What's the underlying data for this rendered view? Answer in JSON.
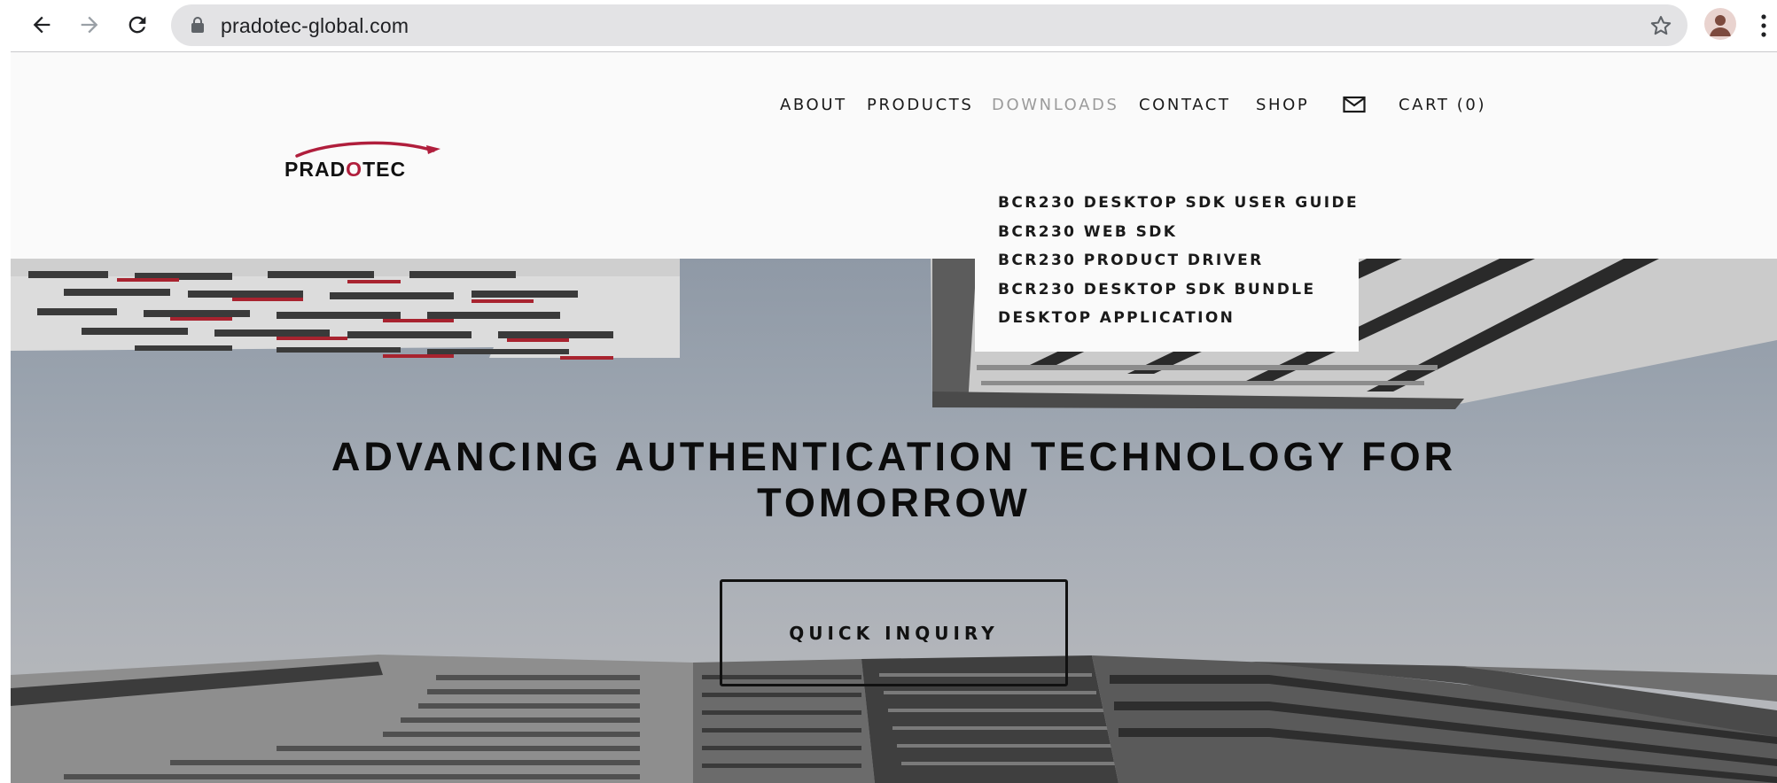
{
  "browser": {
    "url": "pradotec-global.com",
    "icons": {
      "back": "arrow-left-icon",
      "forward": "arrow-right-icon",
      "reload": "reload-icon",
      "lock": "lock-icon",
      "bookmark": "star-icon",
      "profile": "avatar-icon",
      "menu": "kebab-menu-icon"
    }
  },
  "site": {
    "logo_text_pre": "PRAD",
    "logo_text_o": "O",
    "logo_text_post": "TEC",
    "brand_colors": {
      "red": "#b01e3c",
      "dark": "#111111"
    }
  },
  "nav": {
    "about": "ABOUT",
    "products": "PRODUCTS",
    "downloads": "DOWNLOADS",
    "contact": "CONTACT",
    "shop": "SHOP",
    "cart": "CART (0)",
    "mail_icon": "envelope-icon"
  },
  "downloads_menu": {
    "items": [
      "BCR230 DESKTOP SDK USER GUIDE",
      "BCR230 WEB SDK",
      "BCR230 PRODUCT DRIVER",
      "BCR230 DESKTOP SDK BUNDLE",
      "DESKTOP APPLICATION"
    ]
  },
  "hero": {
    "title_line1": "ADVANCING AUTHENTICATION TECHNOLOGY FOR",
    "title_line2": "TOMORROW",
    "button": "QUICK INQUIRY"
  }
}
